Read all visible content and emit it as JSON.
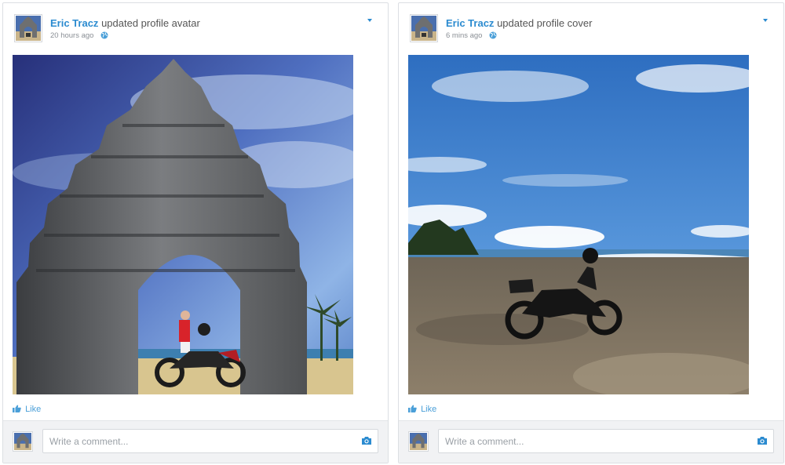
{
  "posts": [
    {
      "author": "Eric Tracz",
      "action": "updated profile avatar",
      "time": "20 hours ago",
      "photo_icon": "temple-gate-with-motorcycle",
      "like_label": "Like",
      "comment_placeholder": "Write a comment..."
    },
    {
      "author": "Eric Tracz",
      "action": "updated profile cover",
      "time": "6 mins ago",
      "photo_icon": "beach-with-motorcycle",
      "like_label": "Like",
      "comment_placeholder": "Write a comment..."
    }
  ],
  "colors": {
    "link_blue": "#2b8bd0",
    "like_blue": "#4a9fd8",
    "footer_bg": "#f1f2f4"
  },
  "icons": {
    "privacy": "globe-icon",
    "menu": "caret-down-icon",
    "like": "thumbs-up-icon",
    "attach": "camera-icon"
  }
}
